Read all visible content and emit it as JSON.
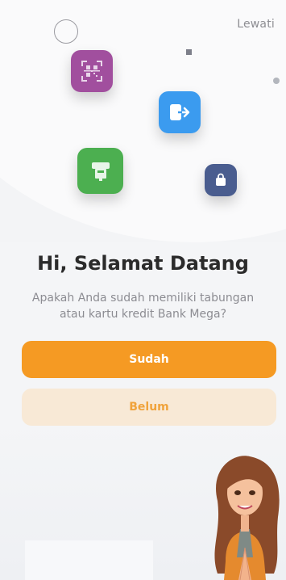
{
  "header": {
    "skip_label": "Lewati"
  },
  "welcome": {
    "title": "Hi, Selamat Datang",
    "subtitle": "Apakah Anda sudah memiliki tabungan atau kartu kredit Bank Mega?"
  },
  "actions": {
    "yes_label": "Sudah",
    "no_label": "Belum"
  },
  "colors": {
    "accent": "#f59a23",
    "secondary_button_bg": "#f8e9d6",
    "qr_icon": "#a14f9e",
    "exit_icon": "#3b9bef",
    "atm_icon": "#4caf50",
    "bag_icon": "#4a5d8f"
  },
  "icons": [
    "qr-scan-icon",
    "exit-icon",
    "atm-icon",
    "shopping-bag-icon"
  ]
}
